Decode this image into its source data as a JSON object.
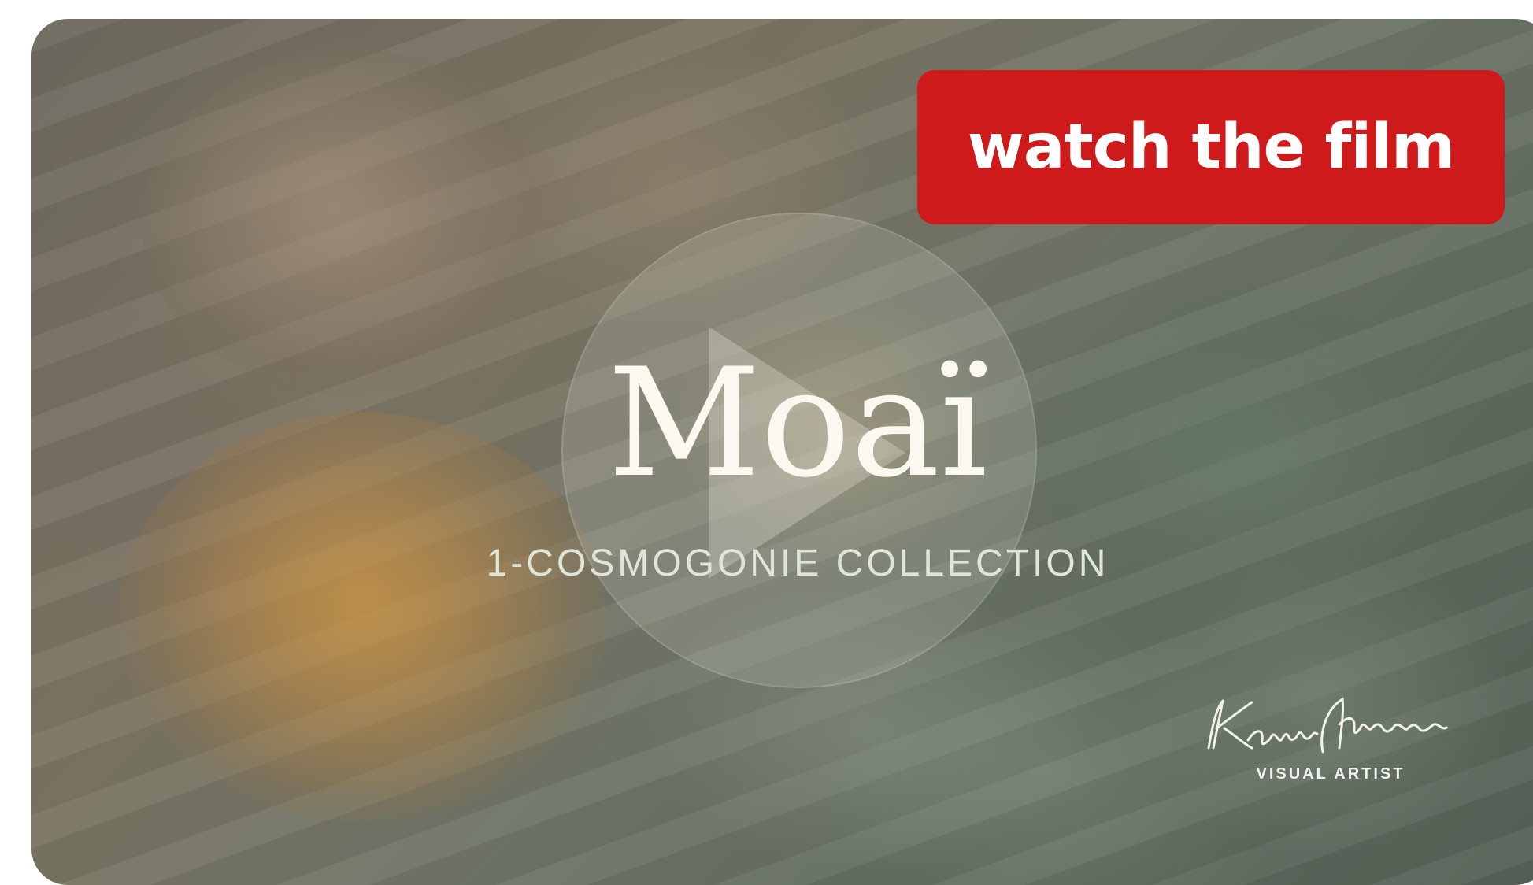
{
  "video": {
    "cta_label": "watch the film",
    "title": "Moaï",
    "subtitle": "1-COSMOGONIE COLLECTION",
    "signature_text": "Karine Mimoun",
    "artist_role": "VISUAL ARTIST",
    "play_icon": "play-icon",
    "colors": {
      "cta_background": "#cf1a1b",
      "cta_text": "#ffffff",
      "title_text": "#fbf8f0",
      "subtitle_text": "#dfe6d8"
    }
  }
}
